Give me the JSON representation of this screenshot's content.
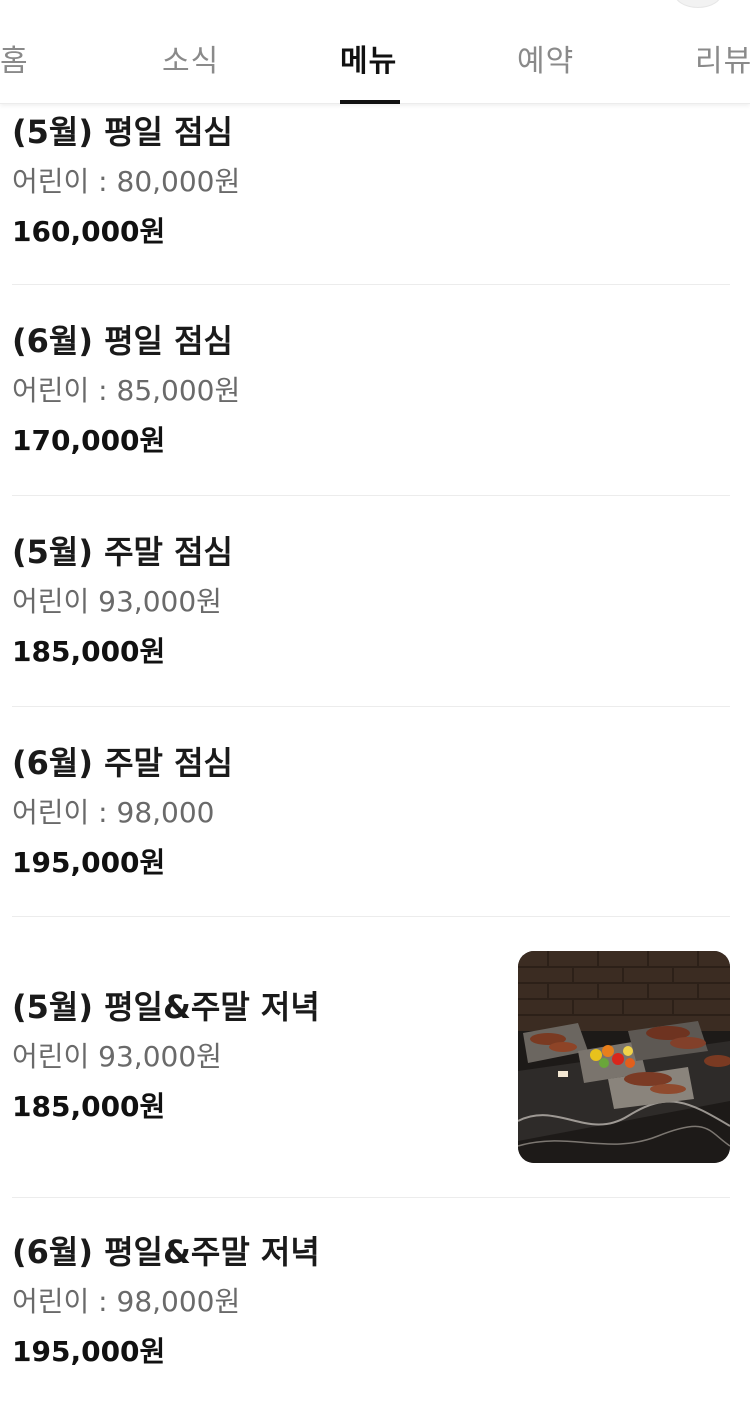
{
  "tabs": [
    {
      "label": "홈",
      "active": false
    },
    {
      "label": "소식",
      "active": false
    },
    {
      "label": "메뉴",
      "active": true
    },
    {
      "label": "예약",
      "active": false
    },
    {
      "label": "리뷰",
      "active": false
    }
  ],
  "menu": [
    {
      "name": "(5월) 평일 점심",
      "desc": "어린이 : 80,000원",
      "price": "160,000원"
    },
    {
      "name": "(6월) 평일 점심",
      "desc": "어린이 : 85,000원",
      "price": "170,000원"
    },
    {
      "name": "(5월) 주말 점심",
      "desc": "어린이 93,000원",
      "price": "185,000원"
    },
    {
      "name": "(6월) 주말 점심",
      "desc": "어린이 : 98,000",
      "price": "195,000원"
    },
    {
      "name": "(5월) 평일&주말 저녁",
      "desc": "어린이 93,000원",
      "price": "185,000원",
      "image": "buffet-grill-photo"
    },
    {
      "name": "(6월) 평일&주말 저녁",
      "desc": "어린이 : 98,000원",
      "price": "195,000원"
    }
  ]
}
